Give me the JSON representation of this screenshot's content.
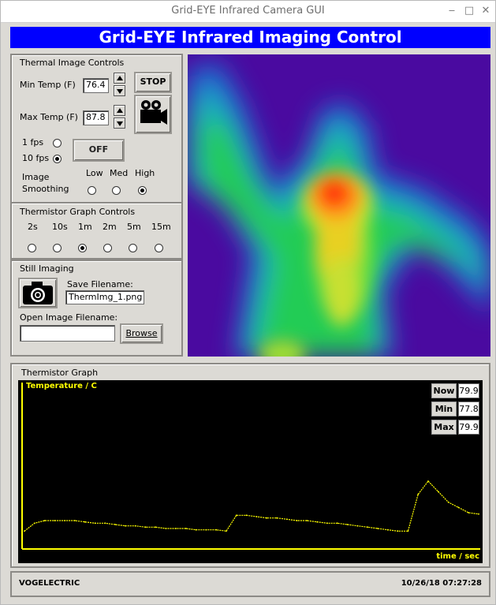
{
  "window": {
    "title": "Grid-EYE Infrared Camera GUI",
    "controls": [
      "‒",
      "□",
      "✕"
    ]
  },
  "banner": "Grid-EYE Infrared Imaging Control",
  "thermal_controls": {
    "title": "Thermal Image Controls",
    "min_label": "Min Temp (F)",
    "min_value": "76.4",
    "max_label": "Max Temp (F)",
    "max_value": "87.8",
    "stop_label": "STOP",
    "fps1_label": "1 fps",
    "fps10_label": "10 fps",
    "fps_selected": "10 fps",
    "off_label": "OFF",
    "smoothing_label_1": "Image",
    "smoothing_label_2": "Smoothing",
    "smoothing_options": [
      "Low",
      "Med",
      "High"
    ],
    "smoothing_selected": "High"
  },
  "graph_controls": {
    "title": "Thermistor Graph Controls",
    "options": [
      "2s",
      "10s",
      "1m",
      "2m",
      "5m",
      "15m"
    ],
    "selected": "1m"
  },
  "still": {
    "title": "Still Imaging",
    "save_label": "Save Filename:",
    "save_value": "ThermImg_1.png",
    "open_label": "Open Image Filename:",
    "open_value": "",
    "browse_label": "Browse"
  },
  "thermistor_graph": {
    "title": "Thermistor Graph",
    "now_label": "Now",
    "now_value": "79.9",
    "min_label": "Min",
    "min_value": "77.8",
    "max_label": "Max",
    "max_value": "79.9"
  },
  "chart_data": {
    "type": "line",
    "title": "",
    "ylabel": "Temperature / C",
    "xlabel": "time / sec",
    "color": "#ffff00",
    "series": [
      {
        "values": [
          78.0,
          78.3,
          78.4,
          78.4,
          78.4,
          78.4,
          78.35,
          78.3,
          78.3,
          78.25,
          78.2,
          78.2,
          78.15,
          78.15,
          78.1,
          78.1,
          78.1,
          78.05,
          78.05,
          78.05,
          78.0,
          78.6,
          78.6,
          78.55,
          78.5,
          78.5,
          78.45,
          78.4,
          78.4,
          78.35,
          78.3,
          78.3,
          78.25,
          78.2,
          78.15,
          78.1,
          78.05,
          78.0,
          78.0,
          79.4,
          79.9,
          79.5,
          79.1,
          78.9,
          78.7,
          78.65
        ]
      }
    ]
  },
  "status": {
    "left": "VOGELECTRIC",
    "right": "10/26/18 07:27:28"
  }
}
